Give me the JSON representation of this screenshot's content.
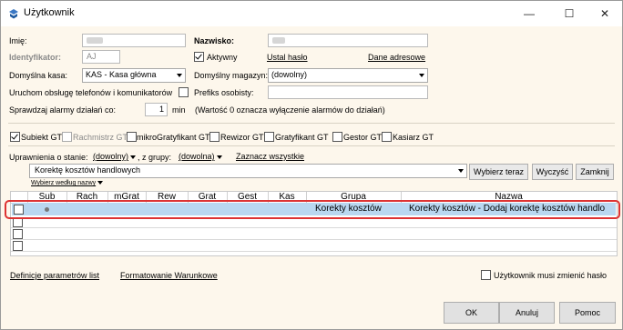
{
  "window": {
    "title": "Użytkownik",
    "minimize": "—",
    "maximize": "☐",
    "close": "✕"
  },
  "form": {
    "imie_label": "Imię:",
    "nazwisko_label": "Nazwisko:",
    "identyfikator_label": "Identyfikator:",
    "identyfikator_value": "AJ",
    "aktywny_label": "Aktywny",
    "ustal_haslo": "Ustal hasło",
    "dane_adresowe": "Dane adresowe",
    "domyslna_kasa_label": "Domyślna kasa:",
    "domyslna_kasa_value": "KAS - Kasa główna",
    "domyslny_magazyn_label": "Domyślny magazyn:",
    "domyslny_magazyn_value": "(dowolny)",
    "uruchom_label": "Uruchom obsługę telefonów i komunikatorów",
    "prefiks_label": "Prefiks osobisty:",
    "alarmy_label": "Sprawdzaj alarmy działań co:",
    "alarmy_value": "1",
    "alarmy_unit": "min",
    "alarmy_hint": "(Wartość 0 oznacza wyłączenie alarmów do działań)"
  },
  "roles": [
    {
      "label": "Subiekt GT",
      "checked": true,
      "disabled": false
    },
    {
      "label": "Rachmistrz GT",
      "checked": false,
      "disabled": true
    },
    {
      "label": "mikroGratyfikant GT",
      "checked": false,
      "disabled": false
    },
    {
      "label": "Rewizor GT",
      "checked": false,
      "disabled": false
    },
    {
      "label": "Gratyfikant GT",
      "checked": false,
      "disabled": false
    },
    {
      "label": "Gestor GT",
      "checked": false,
      "disabled": false
    },
    {
      "label": "Kasiarz GT",
      "checked": false,
      "disabled": false
    }
  ],
  "permissions": {
    "stan_label": "Uprawnienia o stanie:",
    "stan_value": "(dowolny)",
    "grupa_label": ", z grupy:",
    "grupa_value": "(dowolna)",
    "zaznacz": "Zaznacz wszystkie",
    "search_value": "Korektę kosztów handlowych",
    "wybierz_teraz": "Wybierz teraz",
    "wyczysc": "Wyczyść",
    "zamknij": "Zamknij",
    "wybierz_wedlug": "Wybierz według nazwy"
  },
  "grid": {
    "columns": [
      "Sub",
      "Rach",
      "mGrat",
      "Rew",
      "Grat",
      "Gest",
      "Kas",
      "Grupa",
      "Nazwa"
    ],
    "selected_row": {
      "grupa": "Korekty kosztów",
      "nazwa": "Korekty kosztów - Dodaj korektę kosztów handlo"
    }
  },
  "footer": {
    "definicje": "Definicje parametrów list",
    "formatowanie": "Formatowanie Warunkowe",
    "musi_zmienic": "Użytkownik musi zmienić hasło",
    "ok": "OK",
    "anuluj": "Anuluj",
    "pomoc": "Pomoc"
  }
}
